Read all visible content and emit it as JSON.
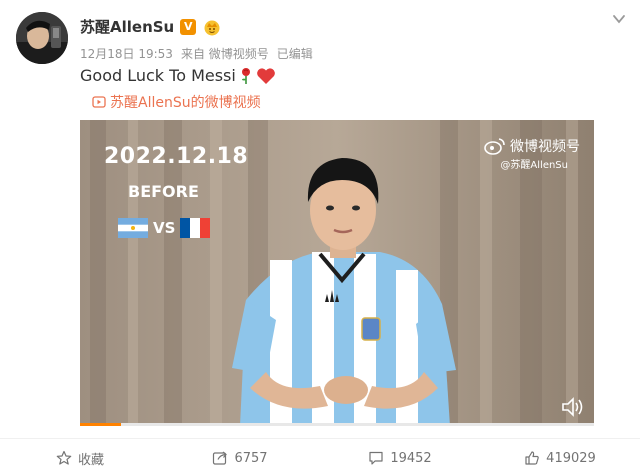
{
  "post": {
    "author": "苏醒AllenSu",
    "verified_badge": "V",
    "timestamp": "12月18日 19:53",
    "source": "来自 微博视频号",
    "edited": "已编辑",
    "text": "Good Luck To Messi",
    "emoji": [
      "rose-emoji",
      "heart-emoji"
    ],
    "video_link_label": "苏醒AllenSu的微博视频"
  },
  "video": {
    "date_text": "2022.12.18",
    "before_text": "BEFORE",
    "vs_text": "VS",
    "watermark_title": "微博视频号",
    "watermark_user": "@苏醒AllenSu",
    "progress": 0.08,
    "flags": [
      "argentina-flag",
      "france-flag"
    ]
  },
  "actions": [
    {
      "icon": "star-icon",
      "label": "收藏"
    },
    {
      "icon": "share-icon",
      "label": "6757"
    },
    {
      "icon": "comment-icon",
      "label": "19452"
    },
    {
      "icon": "like-icon",
      "label": "419029"
    }
  ],
  "colors": {
    "accent": "#eb7350",
    "badge": "#f29100",
    "progress": "#ff8200",
    "muted": "#939393"
  }
}
